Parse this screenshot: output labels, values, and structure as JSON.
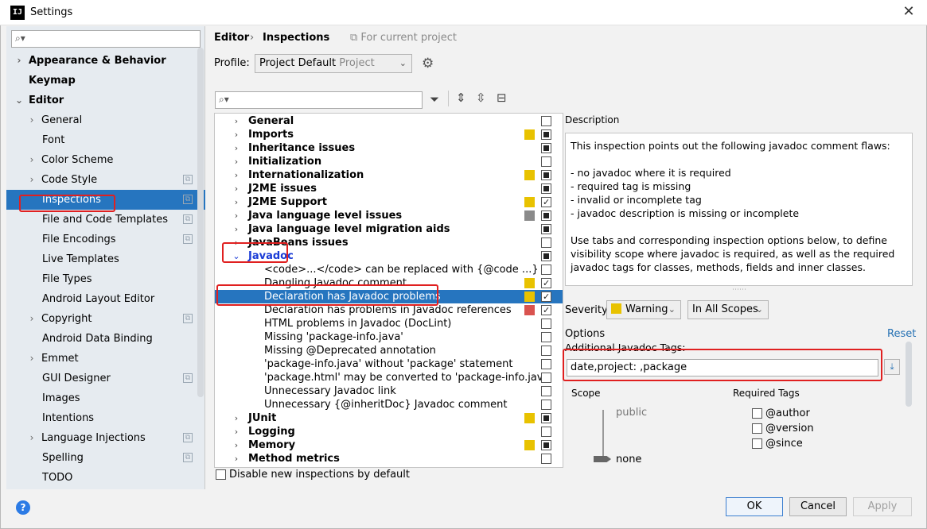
{
  "window": {
    "title": "Settings",
    "app_icon": "IJ"
  },
  "sidebar": {
    "search_placeholder": "",
    "items": [
      {
        "label": "Appearance & Behavior",
        "arrow": "›",
        "bold": true
      },
      {
        "label": "Keymap",
        "arrow": "",
        "bold": true
      },
      {
        "label": "Editor",
        "arrow": "⌄",
        "bold": true
      },
      {
        "label": "General",
        "arrow": "›"
      },
      {
        "label": "Font",
        "arrow": ""
      },
      {
        "label": "Color Scheme",
        "arrow": "›"
      },
      {
        "label": "Code Style",
        "arrow": "›",
        "copy": true
      },
      {
        "label": "Inspections",
        "arrow": "",
        "copy": true,
        "selected": true
      },
      {
        "label": "File and Code Templates",
        "arrow": "",
        "copy": true
      },
      {
        "label": "File Encodings",
        "arrow": "",
        "copy": true
      },
      {
        "label": "Live Templates",
        "arrow": ""
      },
      {
        "label": "File Types",
        "arrow": ""
      },
      {
        "label": "Android Layout Editor",
        "arrow": ""
      },
      {
        "label": "Copyright",
        "arrow": "›",
        "copy": true
      },
      {
        "label": "Android Data Binding",
        "arrow": ""
      },
      {
        "label": "Emmet",
        "arrow": "›"
      },
      {
        "label": "GUI Designer",
        "arrow": "",
        "copy": true
      },
      {
        "label": "Images",
        "arrow": ""
      },
      {
        "label": "Intentions",
        "arrow": ""
      },
      {
        "label": "Language Injections",
        "arrow": "›",
        "copy": true
      },
      {
        "label": "Spelling",
        "arrow": "",
        "copy": true
      },
      {
        "label": "TODO",
        "arrow": ""
      }
    ]
  },
  "header": {
    "crumb1": "Editor",
    "crumb_sep": "›",
    "crumb2": "Inspections",
    "scope_note": "For current project"
  },
  "profile": {
    "label": "Profile:",
    "value": "Project Default",
    "hint": "Project"
  },
  "tree": {
    "rows": [
      {
        "label": "General",
        "group": true,
        "arrow": "›",
        "sev": "",
        "chk": "none"
      },
      {
        "label": "Imports",
        "group": true,
        "arrow": "›",
        "sev": "#e8c200",
        "chk": "partial"
      },
      {
        "label": "Inheritance issues",
        "group": true,
        "arrow": "›",
        "sev": "",
        "chk": "partial"
      },
      {
        "label": "Initialization",
        "group": true,
        "arrow": "›",
        "sev": "",
        "chk": "none"
      },
      {
        "label": "Internationalization",
        "group": true,
        "arrow": "›",
        "sev": "#e8c200",
        "chk": "partial"
      },
      {
        "label": "J2ME issues",
        "group": true,
        "arrow": "›",
        "sev": "",
        "chk": "partial"
      },
      {
        "label": "J2ME Support",
        "group": true,
        "arrow": "›",
        "sev": "#e8c200",
        "chk": "checked"
      },
      {
        "label": "Java language level issues",
        "group": true,
        "arrow": "›",
        "sev": "#8a8a8a",
        "chk": "partial"
      },
      {
        "label": "Java language level migration aids",
        "group": true,
        "arrow": "›",
        "sev": "",
        "chk": "partial"
      },
      {
        "label": "JavaBeans issues",
        "group": true,
        "arrow": "›",
        "sev": "",
        "chk": "none"
      },
      {
        "label": "Javadoc",
        "group": true,
        "arrow": "⌄",
        "sev": "",
        "chk": "partial",
        "blue": true
      },
      {
        "label": "<code>...</code> can be replaced with {@code ...}",
        "group": false,
        "sev": "",
        "chk": "none"
      },
      {
        "label": "Dangling Javadoc comment",
        "group": false,
        "sev": "#e8c200",
        "chk": "checked"
      },
      {
        "label": "Declaration has Javadoc problems",
        "group": false,
        "sev": "#e8c200",
        "chk": "checked",
        "selected": true
      },
      {
        "label": "Declaration has problems in Javadoc references",
        "group": false,
        "sev": "#d9534f",
        "chk": "checked"
      },
      {
        "label": "HTML problems in Javadoc (DocLint)",
        "group": false,
        "sev": "",
        "chk": "none"
      },
      {
        "label": "Missing 'package-info.java'",
        "group": false,
        "sev": "",
        "chk": "none"
      },
      {
        "label": "Missing @Deprecated annotation",
        "group": false,
        "sev": "",
        "chk": "none"
      },
      {
        "label": "'package-info.java' without 'package' statement",
        "group": false,
        "sev": "",
        "chk": "none"
      },
      {
        "label": "'package.html' may be converted to 'package-info.java'",
        "group": false,
        "sev": "",
        "chk": "none"
      },
      {
        "label": "Unnecessary Javadoc link",
        "group": false,
        "sev": "",
        "chk": "none"
      },
      {
        "label": "Unnecessary {@inheritDoc} Javadoc comment",
        "group": false,
        "sev": "",
        "chk": "none"
      },
      {
        "label": "JUnit",
        "group": true,
        "arrow": "›",
        "sev": "#e8c200",
        "chk": "partial"
      },
      {
        "label": "Logging",
        "group": true,
        "arrow": "›",
        "sev": "",
        "chk": "none"
      },
      {
        "label": "Memory",
        "group": true,
        "arrow": "›",
        "sev": "#e8c200",
        "chk": "partial"
      },
      {
        "label": "Method metrics",
        "group": true,
        "arrow": "›",
        "sev": "",
        "chk": "none"
      }
    ]
  },
  "disable_new": "Disable new inspections by default",
  "description": {
    "header": "Description",
    "text": "This inspection points out the following javadoc comment flaws:\n\n- no javadoc where it is required\n- required tag is missing\n- invalid or incomplete tag\n- javadoc description is missing or incomplete\n\nUse tabs and corresponding inspection options below, to define visibility scope where javadoc is required, as well as the required javadoc tags for classes, methods, fields and inner classes."
  },
  "severity": {
    "label": "Severity:",
    "value": "Warning",
    "color": "#e8c200",
    "scope": "In All Scopes"
  },
  "options": {
    "label": "Options",
    "reset": "Reset",
    "tags_label": "Additional Javadoc Tags:",
    "tags_value": "date,project:  ,package",
    "scope_header": "Scope",
    "required_header": "Required Tags",
    "scope_public": "public",
    "scope_none": "none",
    "tags": [
      "@author",
      "@version",
      "@since"
    ]
  },
  "buttons": {
    "ok": "OK",
    "cancel": "Cancel",
    "apply": "Apply",
    "help": "?"
  }
}
